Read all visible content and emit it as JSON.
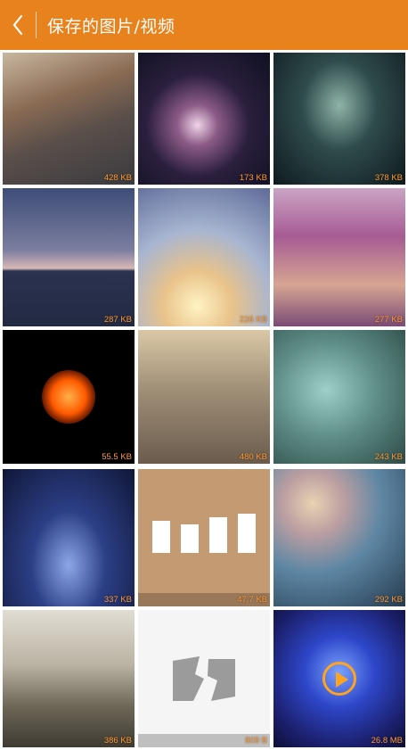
{
  "appbar": {
    "title": "保存的图片/视频"
  },
  "tiles": [
    {
      "size": "428 KB"
    },
    {
      "size": "173 KB"
    },
    {
      "size": "378 KB"
    },
    {
      "size": "287 KB"
    },
    {
      "size": "226 KB"
    },
    {
      "size": "277 KB"
    },
    {
      "size": "55.5 KB"
    },
    {
      "size": "480 KB"
    },
    {
      "size": "243 KB"
    },
    {
      "size": "337 KB"
    },
    {
      "size": "47.7 KB"
    },
    {
      "size": "292 KB"
    },
    {
      "size": "386 KB"
    },
    {
      "size": "809 B"
    },
    {
      "size": "26.8 MB"
    }
  ],
  "icons": {
    "back": "chevron-left-icon",
    "broken_image": "broken-image-icon",
    "video_play": "play-icon"
  },
  "colors": {
    "accent": "#e8821c",
    "size_label": "#ff9a33"
  }
}
